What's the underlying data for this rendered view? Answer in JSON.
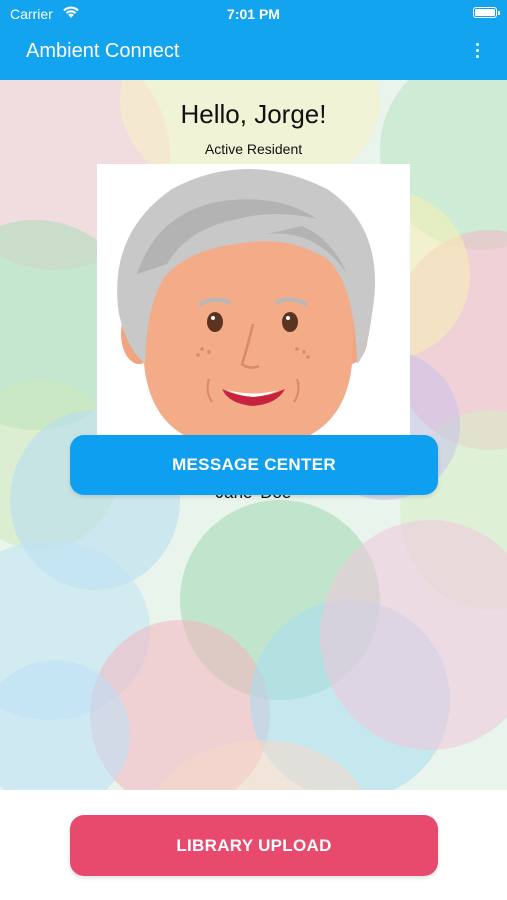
{
  "status_bar": {
    "carrier": "Carrier",
    "time": "7:01 PM"
  },
  "header": {
    "title": "Ambient Connect",
    "menu_icon": "more-vertical-icon"
  },
  "profile": {
    "greeting": "Hello, Jorge!",
    "status": "Active Resident",
    "name": "Jane  Doe"
  },
  "actions": {
    "message_center": "MESSAGE CENTER",
    "library_upload": "LIBRARY UPLOAD"
  },
  "colors": {
    "header": "#13a4ef",
    "message_button": "#0e9ff0",
    "upload_button": "#e84a6d"
  }
}
